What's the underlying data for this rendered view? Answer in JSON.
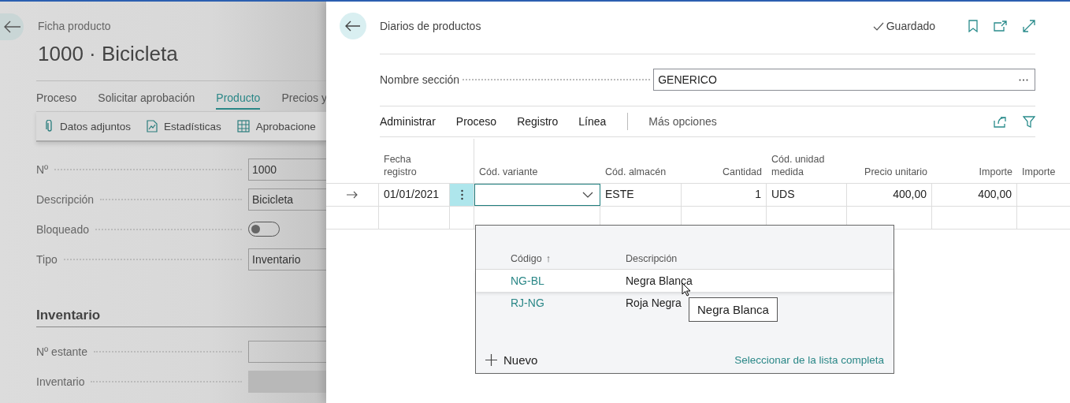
{
  "product_card": {
    "breadcrumb": "Ficha producto",
    "title": "1000 · Bicicleta",
    "tabs": [
      {
        "label": "Proceso",
        "selected": false
      },
      {
        "label": "Solicitar aprobación",
        "selected": false
      },
      {
        "label": "Producto",
        "selected": true
      },
      {
        "label": "Precios y",
        "selected": false
      }
    ],
    "actions": [
      "Datos adjuntos",
      "Estadísticas",
      "Aprobacione"
    ],
    "fields": [
      {
        "label": "Nº",
        "kind": "text",
        "value": "1000"
      },
      {
        "label": "Descripción",
        "kind": "text",
        "value": "Bicicleta"
      },
      {
        "label": "Bloqueado",
        "kind": "toggle",
        "on": false
      },
      {
        "label": "Tipo",
        "kind": "text",
        "value": "Inventario"
      }
    ],
    "section": {
      "title": "Inventario",
      "fields": [
        {
          "label": "Nº estante",
          "kind": "text"
        },
        {
          "label": "Inventario",
          "kind": "readonly"
        }
      ]
    }
  },
  "journal": {
    "title": "Diarios de productos",
    "status": "Guardado",
    "section_field": {
      "label": "Nombre sección",
      "value": "GENERICO"
    },
    "menu": [
      "Administrar",
      "Proceso",
      "Registro",
      "Línea"
    ],
    "more": "Más opciones",
    "columns": [
      "Fecha registro",
      "Cód. variante",
      "Cód. almacén",
      "Cantidad",
      "Cód. unidad medida",
      "Precio unitario",
      "Importe",
      "Importe"
    ],
    "rows": [
      {
        "current": true,
        "cells": [
          "01/01/2021",
          null,
          "ESTE",
          "1",
          "UDS",
          "400,00",
          "400,00",
          null
        ]
      },
      {
        "current": false
      }
    ],
    "lookup": {
      "columns": [
        {
          "label": "Código",
          "sort": "↑"
        },
        {
          "label": "Descripción"
        }
      ],
      "rows": [
        {
          "code": "NG-BL",
          "description": "Negra Blanca",
          "selected": true
        },
        {
          "code": "RJ-NG",
          "description": "Roja Negra",
          "selected": false
        }
      ],
      "new": "Nuevo",
      "full_list": "Seleccionar de la lista completa",
      "tooltip": "Negra Blanca"
    }
  }
}
